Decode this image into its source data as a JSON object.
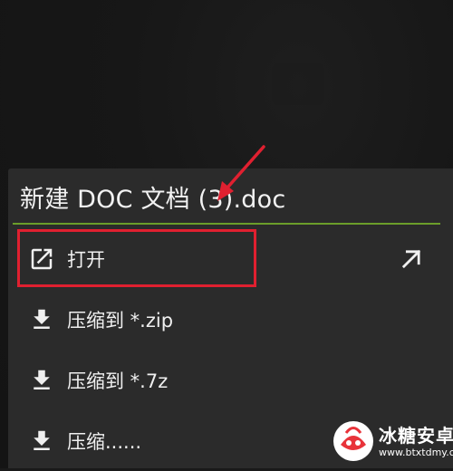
{
  "sheet": {
    "title": "新建 DOC 文档 (3).doc",
    "accent_color": "#6b9e2a",
    "items": [
      {
        "label": "打开",
        "icon": "open-external-icon",
        "trailing_icon": "arrow-up-right-icon"
      },
      {
        "label": "压缩到 *.zip",
        "icon": "download-icon"
      },
      {
        "label": "压缩到 *.7z",
        "icon": "download-icon"
      },
      {
        "label": "压缩......",
        "icon": "download-icon"
      }
    ]
  },
  "annotation": {
    "color": "#e02030"
  },
  "watermark": {
    "title": "冰糖安卓网",
    "url": "www.btxtdmy.com"
  }
}
